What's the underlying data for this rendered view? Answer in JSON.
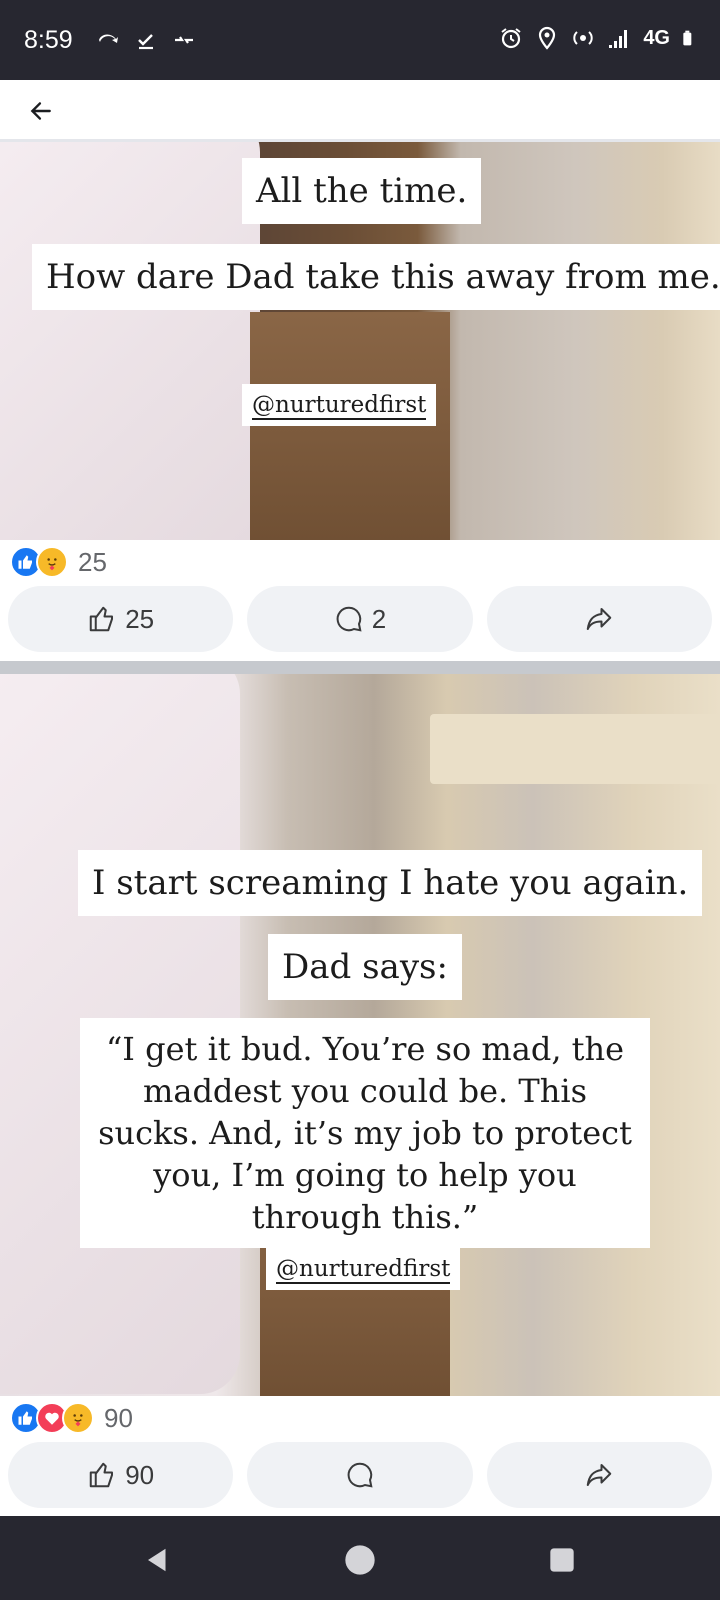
{
  "status_bar": {
    "time": "8:59",
    "network": "4G",
    "icons": [
      "sync-icon",
      "check-icon",
      "data-transfer-icon",
      "alarm-icon",
      "location-icon",
      "hotspot-icon",
      "signal-icon",
      "battery-icon"
    ]
  },
  "top_bar": {
    "back_icon": "back-arrow-icon"
  },
  "posts": [
    {
      "captions": [
        "All the time.",
        "How dare Dad take this away from me."
      ],
      "handle": "@nurturedfirst",
      "reactions": [
        "like",
        "care"
      ],
      "reaction_count": "25",
      "actions": {
        "like_count": "25",
        "comment_count": "2",
        "share_label": ""
      }
    },
    {
      "captions": [
        "I start screaming I hate you again.",
        "Dad says:",
        "“I get it bud. You’re so mad, the maddest you could be. This sucks. And, it’s my job to protect you, I’m going to help you through this.”"
      ],
      "handle": "@nurturedfirst",
      "reactions": [
        "like",
        "love",
        "care"
      ],
      "reaction_count": "90",
      "actions": {
        "like_count": "90",
        "comment_count": "",
        "share_label": ""
      }
    }
  ],
  "colors": {
    "facebook_blue": "#1877f2",
    "love_red": "#f33e58",
    "care_yellow": "#f7b928",
    "status_bar_bg": "#272730"
  }
}
